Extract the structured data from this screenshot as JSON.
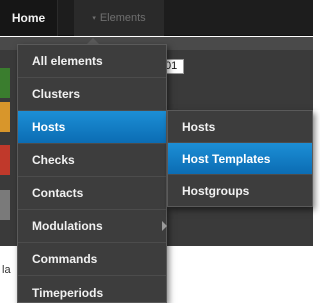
{
  "nav": {
    "home_label": "Home",
    "elements_caret": "▾",
    "elements_label": "Elements"
  },
  "background": {
    "id_value": "01",
    "partial_text": "la",
    "status_colors": [
      "#3a7d2e",
      "#d8962b",
      "#c0392b",
      "#7a7a7a"
    ]
  },
  "menu": {
    "items": [
      {
        "label": "All elements"
      },
      {
        "label": "Clusters"
      },
      {
        "label": "Hosts",
        "active": true
      },
      {
        "label": "Checks"
      },
      {
        "label": "Contacts"
      },
      {
        "label": "Modulations"
      },
      {
        "label": "Commands"
      },
      {
        "label": "Timeperiods"
      }
    ]
  },
  "submenu": {
    "items": [
      {
        "label": "Hosts"
      },
      {
        "label": "Host Templates",
        "active": true
      },
      {
        "label": "Hostgroups"
      }
    ]
  },
  "colors": {
    "active_blue": "#1180c8",
    "menu_bg": "#3d3d3d",
    "navbar_bg": "#1d1d1d"
  }
}
